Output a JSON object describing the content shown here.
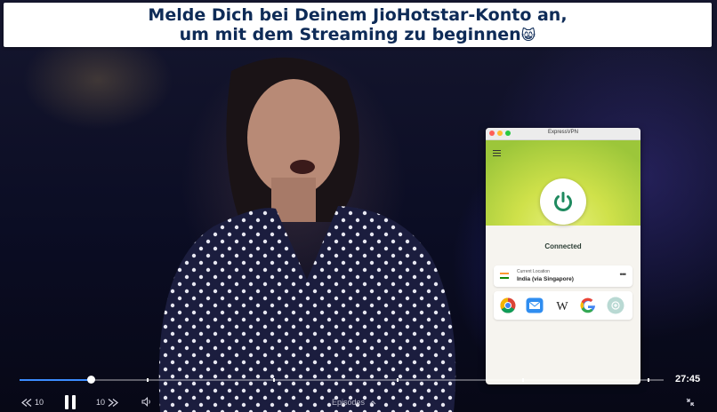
{
  "banner": {
    "line1": "Melde Dich bei Deinem JioHotstar-Konto an,",
    "line2": "um mit dem Streaming zu beginnen",
    "emoji": "😸"
  },
  "player": {
    "progress": 0.11,
    "time_remaining": "27:45",
    "rewind_label": "10",
    "forward_label": "10",
    "episodes_label": "Episodes",
    "icons": [
      "rewind-10-icon",
      "pause-icon",
      "forward-10-icon",
      "volume-icon",
      "chevron-up-icon",
      "collapse-icon"
    ]
  },
  "vpn": {
    "title": "ExpressVPN",
    "status": "Connected",
    "location_label": "Current Location",
    "location_name": "India (via Singapore)",
    "more": "•••",
    "accent": "#cfe14a",
    "power_color": "#1f8a5f",
    "shortcuts": [
      "chrome-icon",
      "mail-icon",
      "wikipedia-icon",
      "google-icon",
      "add-shortcut-icon"
    ]
  }
}
